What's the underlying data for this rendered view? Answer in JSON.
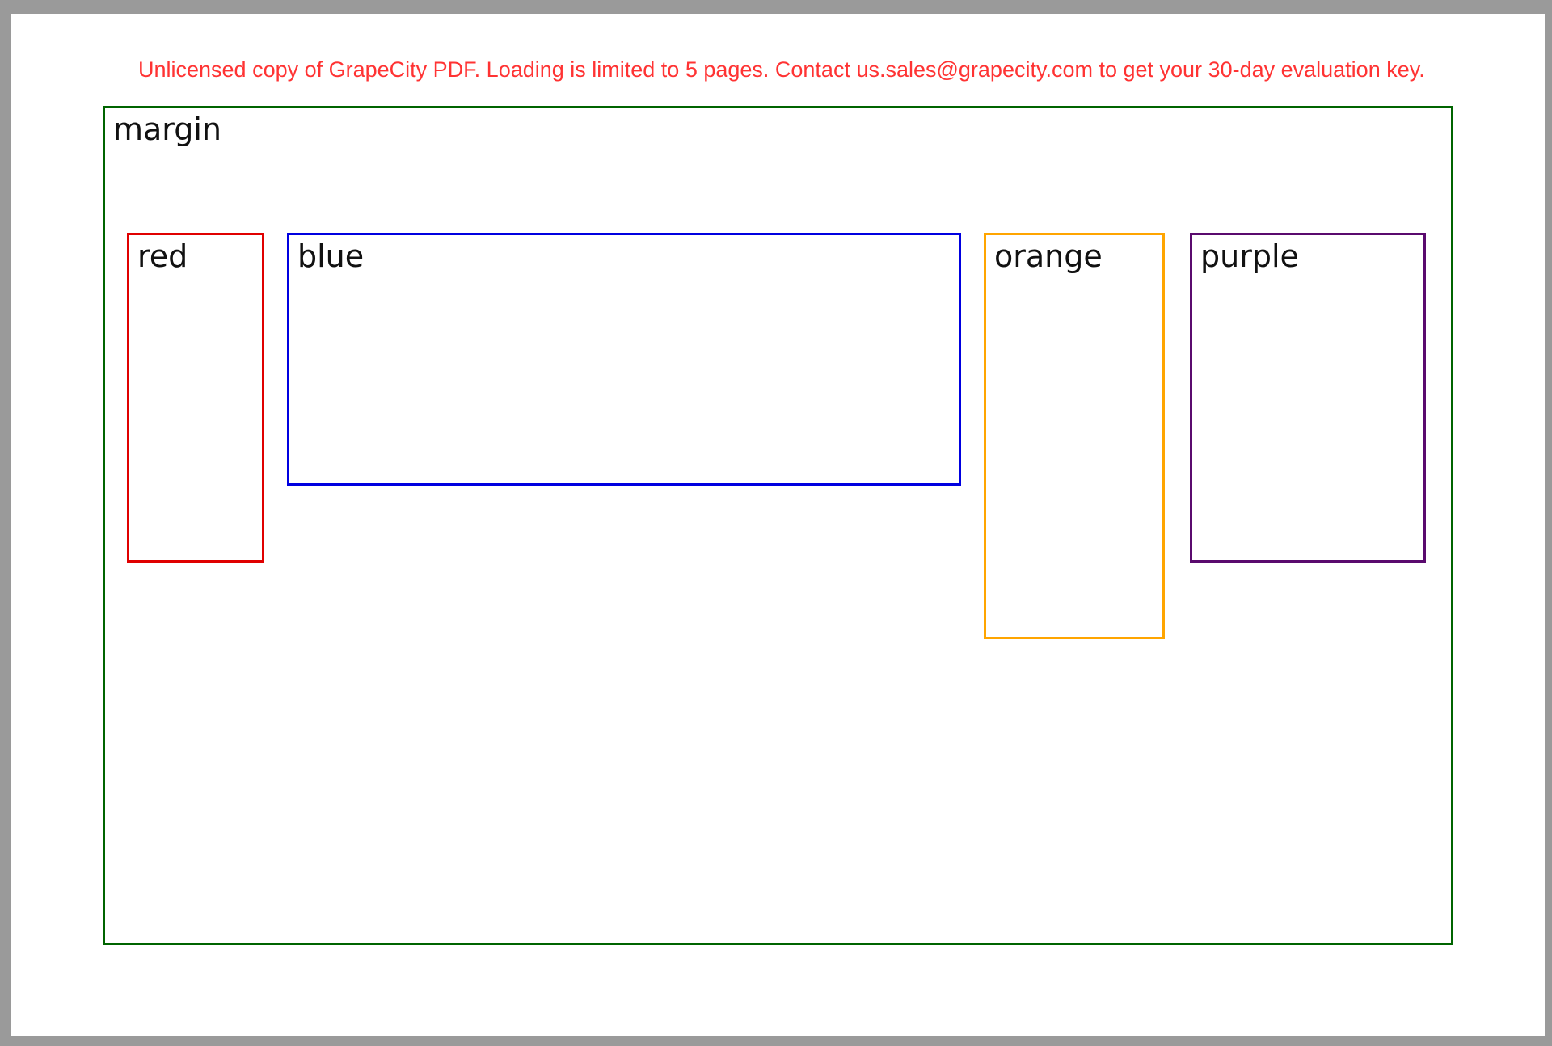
{
  "watermark": {
    "text": "Unlicensed copy of GrapeCity PDF. Loading is limited to 5 pages. Contact us.sales@grapecity.com to get your 30-day evaluation key.",
    "color": "#ff3333"
  },
  "boxes": {
    "margin": {
      "label": "margin",
      "color": "#006400"
    },
    "red": {
      "label": "red",
      "color": "#e00000"
    },
    "blue": {
      "label": "blue",
      "color": "#0000e0"
    },
    "orange": {
      "label": "orange",
      "color": "#ffa500"
    },
    "purple": {
      "label": "purple",
      "color": "#5a0a6e"
    }
  }
}
